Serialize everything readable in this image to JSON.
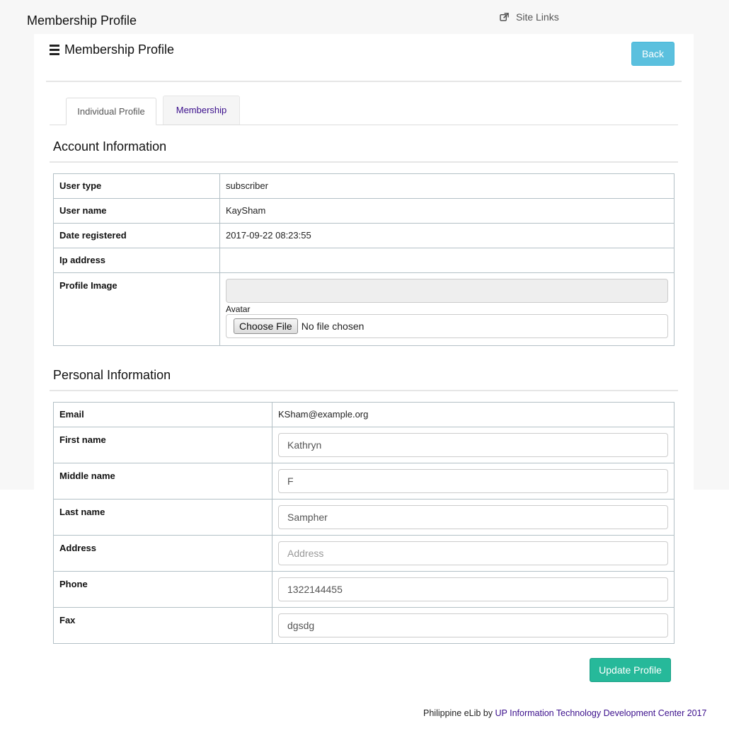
{
  "header": {
    "page_title": "Membership Profile",
    "site_links_label": "Site Links",
    "site_links_icon": "external-link-icon"
  },
  "panel": {
    "title": "Membership Profile",
    "title_icon": "bars-icon",
    "back_label": "Back"
  },
  "tabs": [
    {
      "label": "Individual Profile",
      "active": true
    },
    {
      "label": "Membership",
      "active": false
    }
  ],
  "account": {
    "section_title": "Account Information",
    "rows": {
      "user_type": {
        "label": "User type",
        "value": "subscriber"
      },
      "user_name": {
        "label": "User name",
        "value": "KaySham"
      },
      "date_registered": {
        "label": "Date registered",
        "value": "2017-09-22 08:23:55"
      },
      "ip_address": {
        "label": "Ip address",
        "value": ""
      },
      "profile_image": {
        "label": "Profile Image",
        "avatar_label": "Avatar",
        "choose_file_label": "Choose File",
        "file_status": "No file chosen"
      }
    }
  },
  "personal": {
    "section_title": "Personal Information",
    "email": {
      "label": "Email",
      "value": "KSham@example.org"
    },
    "first_name": {
      "label": "First name",
      "value": "Kathryn",
      "placeholder": ""
    },
    "middle_name": {
      "label": "Middle name",
      "value": "F",
      "placeholder": ""
    },
    "last_name": {
      "label": "Last name",
      "value": "Sampher",
      "placeholder": ""
    },
    "address": {
      "label": "Address",
      "value": "",
      "placeholder": "Address"
    },
    "phone": {
      "label": "Phone",
      "value": "1322144455",
      "placeholder": ""
    },
    "fax": {
      "label": "Fax",
      "value": "dgsdg",
      "placeholder": ""
    }
  },
  "actions": {
    "update_label": "Update Profile"
  },
  "footer": {
    "prefix": "Philippine eLib by",
    "link_text": "UP Information Technology Development Center 2017"
  },
  "colors": {
    "back_button": "#5bc0de",
    "update_button": "#26b99a",
    "link": "#3b0f8c"
  }
}
